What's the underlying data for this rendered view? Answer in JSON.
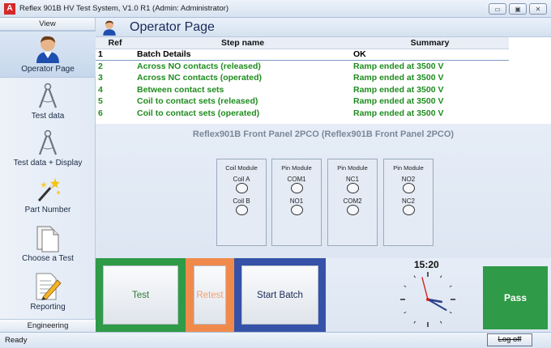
{
  "window": {
    "title": "Reflex 901B HV Test System, V1.0 R1 (Admin: Administrator)",
    "app_icon_letter": "A",
    "controls": {
      "minimize": "▭",
      "maximize": "▣",
      "close": "✕"
    }
  },
  "sidebar": {
    "header": "View",
    "items": [
      {
        "label": "Operator Page",
        "icon": "operator-icon",
        "active": true
      },
      {
        "label": "Test data",
        "icon": "compass-icon"
      },
      {
        "label": "Test data + Display",
        "icon": "compass-icon"
      },
      {
        "label": "Part Number",
        "icon": "magic-wand-icon"
      },
      {
        "label": "Choose a Test",
        "icon": "documents-icon"
      },
      {
        "label": "Reporting",
        "icon": "report-pencil-icon"
      }
    ],
    "footer": "Engineering"
  },
  "page": {
    "title": "Operator Page"
  },
  "steps_table": {
    "headers": [
      "Ref",
      "Step name",
      "Summary"
    ],
    "rows": [
      {
        "ref": "1",
        "step": "Batch Details",
        "summary": "OK",
        "selected": true
      },
      {
        "ref": "2",
        "step": "Across NO contacts (released)",
        "summary": "Ramp ended at 3500 V"
      },
      {
        "ref": "3",
        "step": "Across NC contacts (operated)",
        "summary": "Ramp ended at 3500 V"
      },
      {
        "ref": "4",
        "step": "Between contact sets",
        "summary": "Ramp ended at 3500 V"
      },
      {
        "ref": "5",
        "step": "Coil to contact sets (released)",
        "summary": "Ramp ended at 3500 V"
      },
      {
        "ref": "6",
        "step": "Coil to contact sets (operated)",
        "summary": "Ramp ended at 3500 V"
      }
    ],
    "row_color": "#1f8c1f"
  },
  "front_panel": {
    "title": "Reflex901B Front Panel 2PCO (Reflex901B Front Panel 2PCO)",
    "modules": [
      {
        "title": "Coil Module",
        "pins": [
          "Coil A",
          "Coil B"
        ]
      },
      {
        "title": "Pin Module",
        "pins": [
          "COM1",
          "NO1"
        ]
      },
      {
        "title": "Pin Module",
        "pins": [
          "NC1",
          "COM2"
        ]
      },
      {
        "title": "Pin Module",
        "pins": [
          "NO2",
          "NC2"
        ]
      }
    ]
  },
  "controls": {
    "test": {
      "label": "Test",
      "frame_color": "#2f9a48",
      "text_color": "#2f7a36"
    },
    "retest": {
      "label": "Retest",
      "frame_color": "#f08a4b",
      "text_color": "#f5a070"
    },
    "start_batch": {
      "label": "Start Batch",
      "frame_color": "#3552a8",
      "text_color": "#1a2a58"
    }
  },
  "clock": {
    "time": "15:20",
    "hour": 3,
    "minute": 20
  },
  "result": {
    "label": "Pass",
    "color": "#2f9a48"
  },
  "status_bar": {
    "status": "Ready",
    "logoff_label": "Log off"
  }
}
